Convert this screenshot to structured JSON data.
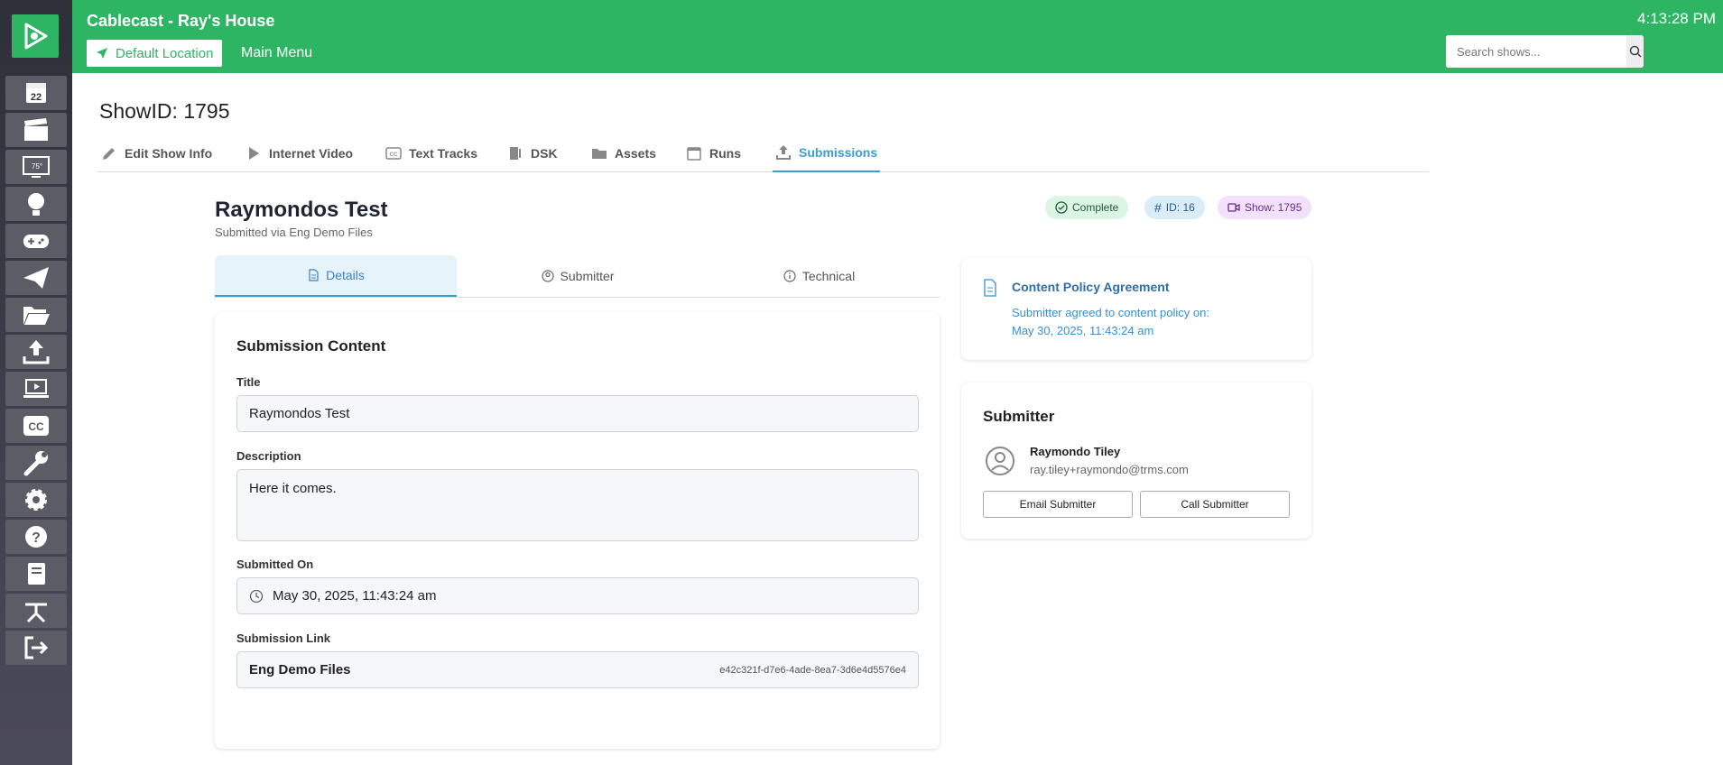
{
  "app": {
    "title": "Cablecast - Ray's House",
    "location_label": "Default Location",
    "main_menu_label": "Main Menu",
    "clock": "4:13:28 PM",
    "search_placeholder": "Search shows..."
  },
  "sidebar": {
    "items": [
      {
        "icon": "calendar-icon"
      },
      {
        "icon": "clapperboard-icon"
      },
      {
        "icon": "monitor-weather-icon"
      },
      {
        "icon": "presenter-icon"
      },
      {
        "icon": "gamepad-icon"
      },
      {
        "icon": "paper-plane-icon"
      },
      {
        "icon": "folder-open-icon"
      },
      {
        "icon": "upload-icon"
      },
      {
        "icon": "laptop-play-icon"
      },
      {
        "icon": "closed-caption-icon"
      },
      {
        "icon": "wrench-icon"
      },
      {
        "icon": "gear-icon"
      },
      {
        "icon": "help-icon"
      },
      {
        "icon": "book-icon"
      },
      {
        "icon": "network-icon"
      },
      {
        "icon": "logout-icon"
      }
    ]
  },
  "page": {
    "show_id_label": "ShowID: 1795",
    "tabs": [
      {
        "label": "Edit Show Info",
        "icon": "pencil-icon"
      },
      {
        "label": "Internet Video",
        "icon": "play-icon"
      },
      {
        "label": "Text Tracks",
        "icon": "closed-caption-icon"
      },
      {
        "label": "DSK",
        "icon": "dsk-icon"
      },
      {
        "label": "Assets",
        "icon": "folder-icon"
      },
      {
        "label": "Runs",
        "icon": "calendar-icon"
      },
      {
        "label": "Submissions",
        "icon": "upload-icon",
        "active": true
      }
    ]
  },
  "submission": {
    "title": "Raymondos Test",
    "via": "Submitted via Eng Demo Files",
    "badges": {
      "status": "Complete",
      "id": "ID: 16",
      "show": "Show: 1795"
    },
    "subtabs": [
      {
        "label": "Details",
        "active": true
      },
      {
        "label": "Submitter"
      },
      {
        "label": "Technical"
      }
    ],
    "content_heading": "Submission Content",
    "fields": {
      "title_label": "Title",
      "title_value": "Raymondos Test",
      "description_label": "Description",
      "description_value": "Here it comes.",
      "submitted_on_label": "Submitted On",
      "submitted_on_value": "May 30, 2025, 11:43:24 am",
      "link_label": "Submission Link",
      "link_name": "Eng Demo Files",
      "link_id": "e42c321f-d7e6-4ade-8ea7-3d6e4d5576e4"
    },
    "policy": {
      "title": "Content Policy Agreement",
      "line1": "Submitter agreed to content policy on:",
      "line2": "May 30, 2025, 11:43:24 am"
    },
    "submitter": {
      "heading": "Submitter",
      "name": "Raymondo Tiley",
      "email": "ray.tiley+raymondo@trms.com",
      "email_button": "Email Submitter",
      "call_button": "Call Submitter"
    }
  },
  "colors": {
    "brand_green": "#2db564",
    "accent_blue": "#3b9ecf",
    "sidebar_dark": "#2f2f3a"
  }
}
